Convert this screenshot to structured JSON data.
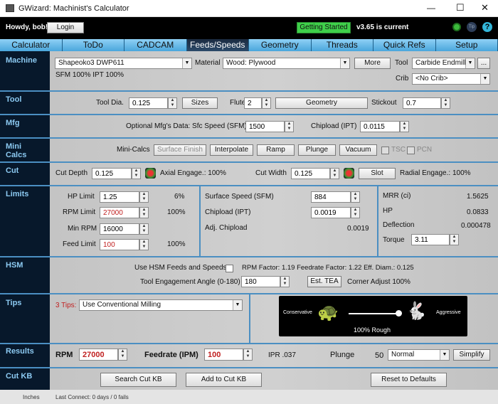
{
  "window": {
    "title": "GWizard: Machinist's Calculator",
    "min": "—",
    "max": "☐",
    "close": "✕"
  },
  "header": {
    "greeting": "Howdy, bob!",
    "login": "Login",
    "getting_started": "Getting Started",
    "version": "v3.65 is current",
    "tip": "Tip",
    "help": "?"
  },
  "tabs": [
    "Calculator",
    "ToDo",
    "CADCAM",
    "Feeds/Speeds",
    "Geometry",
    "Threads",
    "Quick Refs",
    "Setup"
  ],
  "active_tab": "Feeds/Speeds",
  "sections": [
    "Machine",
    "Tool",
    "Mfg",
    "Mini\nCalcs",
    "Cut",
    "Limits",
    "HSM",
    "Tips",
    "Results",
    "Cut KB"
  ],
  "machine": {
    "machine": "Shapeoko3 DWP611",
    "material_label": "Material",
    "material": "Wood: Plywood",
    "more": "More",
    "tool_label": "Tool",
    "tool": "Carbide Endmill",
    "ellipsis": "...",
    "factors": "SFM 100%  IPT 100%",
    "crib_label": "Crib",
    "crib": "<No Crib>"
  },
  "tool": {
    "dia_label": "Tool Dia.",
    "dia": "0.125",
    "sizes": "Sizes",
    "flutes_label": "Flutes",
    "flutes": "2",
    "geometry": "Geometry",
    "stickout_label": "Stickout",
    "stickout": "0.7"
  },
  "mfg": {
    "sfc_label": "Optional Mfg's Data: Sfc Speed (SFM)",
    "sfc": "1500",
    "chipload_label": "Chipload (IPT)",
    "chipload": "0.0115"
  },
  "mini": {
    "label": "Mini-Calcs",
    "buttons": [
      "Surface Finish",
      "Interpolate",
      "Ramp",
      "Plunge",
      "Vacuum"
    ],
    "tsc": "TSC",
    "pcn": "PCN"
  },
  "cut": {
    "depth_label": "Cut Depth",
    "depth": "0.125",
    "axial": "Axial Engage.: 100%",
    "width_label": "Cut Width",
    "width": "0.125",
    "slot": "Slot",
    "radial": "Radial Engage.: 100%"
  },
  "limits": {
    "hp_label": "HP Limit",
    "hp": "1.25",
    "hp_pct": "6%",
    "rpm_label": "RPM Limit",
    "rpm": "27000",
    "rpm_pct": "100%",
    "minrpm_label": "Min RPM",
    "minrpm": "16000",
    "feed_label": "Feed Limit",
    "feed": "100",
    "feed_pct": "100%",
    "sfm_label": "Surface Speed (SFM)",
    "sfm": "884",
    "chip_label": "Chipload (IPT)",
    "chip": "0.0019",
    "adj_label": "Adj. Chipload",
    "adj": "0.0019",
    "mrr_label": "MRR (ci)",
    "mrr": "1.5625",
    "hpv_label": "HP",
    "hpv": "0.0833",
    "defl_label": "Deflection",
    "defl": "0.000478",
    "torque_label": "Torque",
    "torque": "3.11"
  },
  "hsm": {
    "use_label": "Use HSM Feeds and Speeds",
    "factors": "RPM Factor: 1.19  Feedrate Factor: 1.22  Eff. Diam.: 0.125",
    "tea_label": "Tool Engagement Angle (0-180)",
    "tea": "180",
    "est": "Est. TEA",
    "corner": "Corner Adjust 100%"
  },
  "tips": {
    "count": "3 Tips:",
    "tip": "Use Conventional Milling",
    "conservative": "Conservative",
    "aggressive": "Aggressive",
    "slider_value": "100% Rough",
    "slider_fraction": 1.0
  },
  "results": {
    "rpm_label": "RPM",
    "rpm": "27000",
    "feed_label": "Feedrate (IPM)",
    "feed": "100",
    "ipr": "IPR .037",
    "plunge_label": "Plunge",
    "plunge": "50",
    "mode": "Normal",
    "simplify": "Simplify"
  },
  "cutkb": {
    "search": "Search Cut KB",
    "add": "Add to Cut KB",
    "reset": "Reset to Defaults"
  },
  "status": {
    "units": "Inches",
    "connect": "Last Connect: 0 days / 0 fails"
  },
  "colors": {
    "accent": "#4aa6dc",
    "sidebar": "#07182b",
    "warning_text": "#c02020",
    "getting_started": "#3fcf4a"
  }
}
